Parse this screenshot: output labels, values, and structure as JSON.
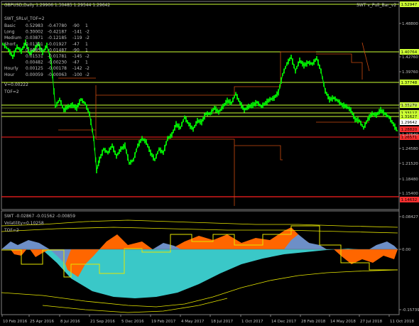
{
  "colors": {
    "background": "#000000",
    "grid": "#2a2a2a",
    "axis": "#808080",
    "candles": "#00ff00",
    "level_line": "#ccff33",
    "red_line": "#ff2020",
    "orange_step": "#cc4a10",
    "fill_cyan": "#3ac8c8",
    "fill_orange": "#ff6600",
    "fill_blue": "#6d8fc7",
    "band_yellow": "#e6e600",
    "label_bg_yellow": "#ccff33",
    "label_bg_red": "#ff3030"
  },
  "main_panel": {
    "symbol_header": "GBPUSD,Daily  1.29906 1.30485 1.29544 1.29642",
    "indicator_name": "SWT_SRLvl_TOF=2",
    "right_label": "SWT v_Pull_Bar_v2",
    "stats": [
      {
        "name": "Basic",
        "v1": "0.52983",
        "v2": "-0.47780",
        "v3": "-90",
        "v4": "1"
      },
      {
        "name": "Long",
        "v1": "0.30002",
        "v2": "-0.42187",
        "v3": "-141",
        "v4": "-2"
      },
      {
        "name": "Medium",
        "v1": "0.03871",
        "v2": "-0.12185",
        "v3": "-119",
        "v4": "-2"
      },
      {
        "name": "Short",
        "v1": "0.01301",
        "v2": "-0.01927",
        "v3": "-47",
        "v4": "1"
      },
      {
        "name": "",
        "v1": "0.00853",
        "v2": "-0.01487",
        "v3": "-90",
        "v4": "1"
      },
      {
        "name": "",
        "v1": "0.01531",
        "v2": "-0.01781",
        "v3": "-145",
        "v4": "-2"
      },
      {
        "name": "",
        "v1": "0.00482",
        "v2": "-0.00230",
        "v3": "-47",
        "v4": "1"
      },
      {
        "name": "Hourly",
        "v1": "0.00125",
        "v2": "-0.00178",
        "v3": "-142",
        "v4": "-2"
      },
      {
        "name": "Hour",
        "v1": "0.00059",
        "v2": "-0.00063",
        "v3": "-100",
        "v4": "-2"
      }
    ],
    "v_label": "V=0.00222",
    "tof_label": "TOF=2",
    "price_ticks": [
      "1.48800",
      "1.42760",
      "1.39760",
      "1.33620",
      "1.27640",
      "1.24580",
      "1.21520",
      "1.18480",
      "1.15400"
    ],
    "price_labels": [
      {
        "text": "1.52947",
        "style": "yellow"
      },
      {
        "text": "1.40764",
        "style": "yellow"
      },
      {
        "text": "1.37748",
        "style": "yellow"
      },
      {
        "text": "1.35279",
        "style": "yellow"
      },
      {
        "text": "1.33117",
        "style": "yellow"
      },
      {
        "text": "1.31627",
        "style": "yellow"
      },
      {
        "text": "1.29642",
        "style": "white"
      },
      {
        "text": "1.28820",
        "style": "red"
      },
      {
        "text": "1.26571",
        "style": "red"
      },
      {
        "text": "1.14632",
        "style": "red"
      }
    ]
  },
  "sub_panel": {
    "header": "SWT -0.02867 -0.01562 -0.00859",
    "volatility": "Volatility=0.10258",
    "tof": "TOF=2",
    "ticks": [
      "0.08427",
      "0.00",
      "-0.15739"
    ]
  },
  "x_axis": {
    "labels": [
      "10 Feb 2016",
      "25 Apr 2016",
      "8 Jul 2016",
      "21 Sep 2016",
      "5 Dec 2016",
      "19 Feb 2017",
      "4 May 2017",
      "18 Jul 2017",
      "1 Oct 2017",
      "14 Dec 2017",
      "28 Feb 2018",
      "14 May 2018",
      "27 Jul 2018",
      "11 Oct 2018"
    ]
  }
}
